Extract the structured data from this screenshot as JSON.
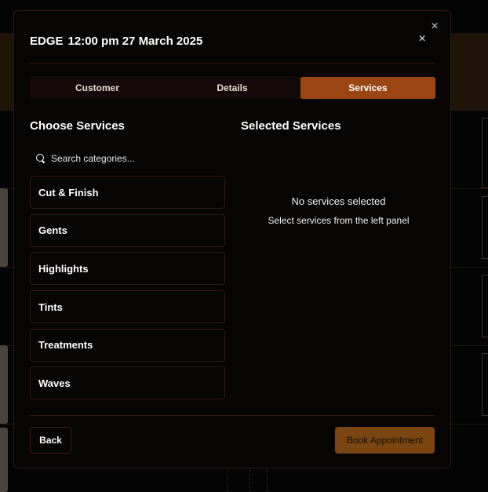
{
  "modal": {
    "brand": "EDGE",
    "datetime": "12:00 pm 27 March 2025",
    "close_outer": "×",
    "close_inner": "×"
  },
  "tabs": [
    {
      "label": "Customer",
      "active": false
    },
    {
      "label": "Details",
      "active": false
    },
    {
      "label": "Services",
      "active": true
    }
  ],
  "left": {
    "title": "Choose Services",
    "search_placeholder": "Search categories...",
    "categories": [
      "Cut & Finish",
      "Gents",
      "Highlights",
      "Tints",
      "Treatments",
      "Waves"
    ]
  },
  "right": {
    "title": "Selected Services",
    "empty_title": "No services selected",
    "empty_subtitle": "Select services from the left panel"
  },
  "footer": {
    "back_label": "Back",
    "book_label": "Book Appointment"
  },
  "colors": {
    "accent": "#9a4512",
    "book_button": "#7a4510",
    "modal_bg": "#070404",
    "border": "#2e1a16"
  }
}
